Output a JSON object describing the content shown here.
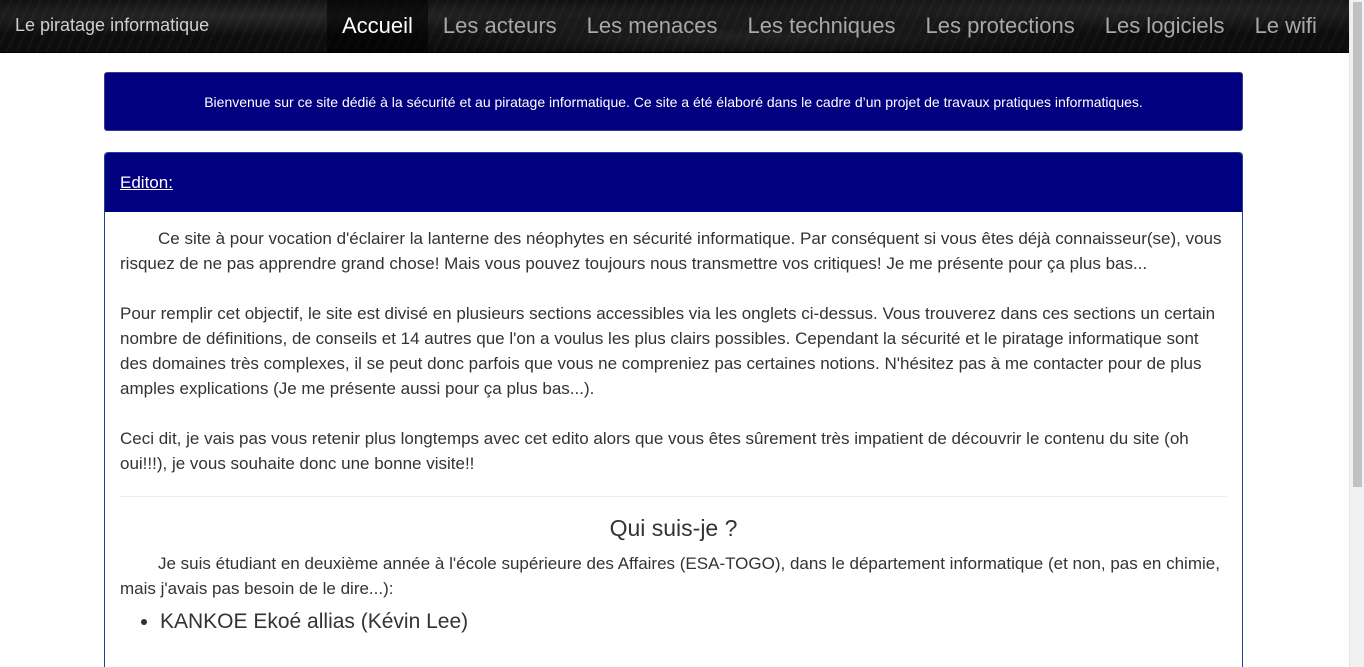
{
  "navbar": {
    "brand": "Le piratage informatique",
    "items": [
      {
        "label": "Accueil",
        "active": true
      },
      {
        "label": "Les acteurs",
        "active": false
      },
      {
        "label": "Les menaces",
        "active": false
      },
      {
        "label": "Les techniques",
        "active": false
      },
      {
        "label": "Les protections",
        "active": false
      },
      {
        "label": "Les logiciels",
        "active": false
      },
      {
        "label": "Le wifi",
        "active": false
      }
    ]
  },
  "welcome": {
    "text": "Bienvenue sur ce site dédié à la sécurité et au piratage informatique. Ce site a été élaboré dans le cadre d’un projet de travaux pratiques informatiques."
  },
  "edito": {
    "title": "Editon:",
    "paragraphs": [
      "Ce site à pour vocation d'éclairer la lanterne des néophytes en sécurité informatique. Par conséquent si vous êtes déjà connaisseur(se), vous risquez de ne pas apprendre grand chose! Mais vous pouvez toujours nous transmettre vos critiques! Je me présente pour ça plus bas...",
      "Pour remplir cet objectif, le site est divisé en plusieurs sections accessibles via les onglets ci-dessus. Vous trouverez dans ces sections un certain nombre de définitions, de conseils et 14 autres que l'on a voulus les plus clairs possibles. Cependant la sécurité et le piratage informatique sont des domaines très complexes, il se peut donc parfois que vous ne compreniez pas certaines notions. N'hésitez pas à me contacter pour de plus amples explications (Je me présente aussi pour ça plus bas...).",
      "Ceci dit, je vais pas vous retenir plus longtemps avec cet edito alors que vous êtes sûrement très impatient de découvrir le contenu du site (oh oui!!!), je vous souhaite donc une bonne visite!!"
    ]
  },
  "about": {
    "title": "Qui suis-je ?",
    "intro": "Je suis étudiant en deuxième année à l'école supérieure des Affaires (ESA-TOGO), dans le département informatique (et non, pas en chimie, mais j'avais pas besoin de le dire...):",
    "items": [
      "KANKOE Ekoé allias (Kévin Lee)"
    ]
  },
  "colors": {
    "navbar_bg": "#0d0d0d",
    "panel_blue": "#000080",
    "text": "#333333"
  }
}
